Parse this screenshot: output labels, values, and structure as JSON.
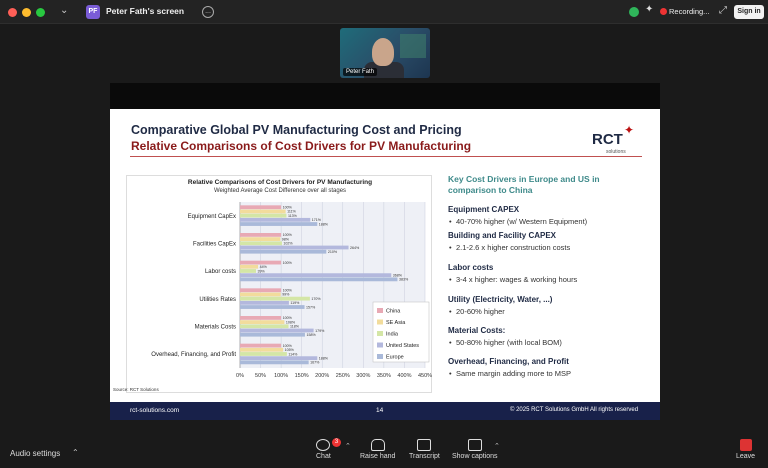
{
  "window": {
    "app_badge": "PF",
    "title": "Peter Fath's screen",
    "more_button": "...",
    "recording_label": "Recording...",
    "signin_label": "Sign in"
  },
  "video": {
    "participant_name": "Peter Fath"
  },
  "slide": {
    "title": "Comparative Global PV Manufacturing Cost and Pricing",
    "subtitle": "Relative Comparisons of Cost Drivers for PV Manufacturing",
    "logo_text": "RCT",
    "logo_sub": "solutions",
    "right_heading": "Key Cost Drivers in Europe and US in comparison to China",
    "drivers": [
      {
        "heading": "Equipment CAPEX",
        "bullet": "40-70% higher (w/ Western Equipment)"
      },
      {
        "heading": "Building and Facility CAPEX",
        "bullet": "2.1-2.6 x higher construction costs"
      },
      {
        "heading": "Labor costs",
        "bullet": "3-4 x higher: wages & working hours"
      },
      {
        "heading": "Utility (Electricity, Water, ...)",
        "bullet": "20-60% higher"
      },
      {
        "heading": "Material Costs:",
        "bullet": "50-80% higher (with local BOM)"
      },
      {
        "heading": "Overhead, Financing, and Profit",
        "bullet": "Same margin adding more to MSP"
      }
    ],
    "footer_left": "rct-solutions.com",
    "footer_page": "14",
    "footer_right": "© 2025 RCT Solutions GmbH All rights reserved",
    "source": "Source: RCT Solutions"
  },
  "chart_data": {
    "type": "bar",
    "orientation": "horizontal",
    "title": "Relative Comparisons of Cost Drivers for PV Manufacturing",
    "subtitle": "Weighted Average Cost Difference over all stages",
    "categories": [
      "Equipment CapEx",
      "Facilities CapEx",
      "Labor costs",
      "Utilities Rates",
      "Materials Costs",
      "Overhead, Financing, and Profit"
    ],
    "series": [
      {
        "name": "China",
        "color": "#e8a9b4",
        "values": [
          100,
          100,
          100,
          100,
          100,
          100
        ]
      },
      {
        "name": "SE Asia",
        "color": "#f2dc9c",
        "values": [
          111,
          98,
          44,
          99,
          108,
          105
        ]
      },
      {
        "name": "India",
        "color": "#d4e6a6",
        "values": [
          113,
          102,
          39,
          170,
          118,
          114
        ]
      },
      {
        "name": "United States",
        "color": "#b3b8dd",
        "values": [
          171,
          264,
          368,
          119,
          179,
          188
        ]
      },
      {
        "name": "Europe",
        "color": "#a9b9d9",
        "values": [
          188,
          210,
          383,
          157,
          158,
          167
        ]
      }
    ],
    "labels": [
      [
        "100%",
        "111%",
        "113%",
        "171%",
        "188%"
      ],
      [
        "100%",
        "98%",
        "102%",
        "264%",
        "210%"
      ],
      [
        "100%",
        "44%",
        "39%",
        "368%",
        "383%"
      ],
      [
        "100%",
        "99%",
        "170%",
        "119%",
        "157%"
      ],
      [
        "100%",
        "108%",
        "118%",
        "179%",
        "158%"
      ],
      [
        "100%",
        "105%",
        "114%",
        "188%",
        "167%"
      ]
    ],
    "x_ticks": [
      "0%",
      "50%",
      "100%",
      "150%",
      "200%",
      "250%",
      "300%",
      "350%",
      "400%",
      "450%"
    ],
    "xlim": [
      0,
      450
    ],
    "legend_position": "bottom-right",
    "grid": true
  },
  "toolbar": {
    "audio_label": "Audio settings",
    "chat_label": "Chat",
    "chat_badge": "3",
    "raise_hand_label": "Raise hand",
    "transcript_label": "Transcript",
    "captions_label": "Show captions",
    "leave_label": "Leave"
  }
}
